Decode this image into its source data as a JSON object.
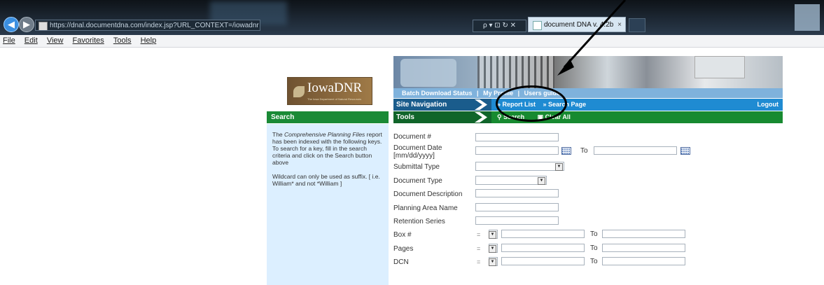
{
  "browser": {
    "address": "https://dnal.documentdna.com/index.jsp?URL_CONTEXT=/iowadnr",
    "address_domain": "documentdna.com",
    "address_tools": "ρ ▾ ⊡ ↻ ✕",
    "tab_title": "document DNA v. 4.2b",
    "tab_close": "×"
  },
  "menu": [
    "File",
    "Edit",
    "View",
    "Favorites",
    "Tools",
    "Help"
  ],
  "logo": {
    "title": "IowaDNR",
    "subtitle": "The Iowa Department of Natural Resources"
  },
  "top_links": [
    "Batch Download Status",
    "|",
    "My Profile",
    "|",
    "Users guide"
  ],
  "site_nav": {
    "label": "Site Navigation",
    "links": [
      "» Report List",
      "» Search Page"
    ],
    "logout": "Logout"
  },
  "tools": {
    "label": "Tools",
    "actions": [
      "Search",
      "Clear All"
    ]
  },
  "sidebar": {
    "title": "Search",
    "p1_pre": "The ",
    "p1_em": "Comprehensive Planning Files",
    "p1_post": " report has been indexed with the following keys. To search for a key, fill in the search criteria and click on the Search button above",
    "p2": "Wildcard can only be used as suffix. [ i.e. William* and not *William ]"
  },
  "form": {
    "document_no": "Document #",
    "document_date": "Document Date [mm/dd/yyyy]",
    "to": "To",
    "submittal_type": "Submittal Type",
    "document_type": "Document Type",
    "document_description": "Document Description",
    "planning_area_name": "Planning Area Name",
    "retention_series": "Retention Series",
    "box_no": "Box #",
    "pages": "Pages",
    "dcn": "DCN",
    "operator": "="
  },
  "colors": {
    "green": "#1a8a36",
    "nav_blue": "#1f8bd2",
    "sidebar_bg": "#dcefff"
  }
}
